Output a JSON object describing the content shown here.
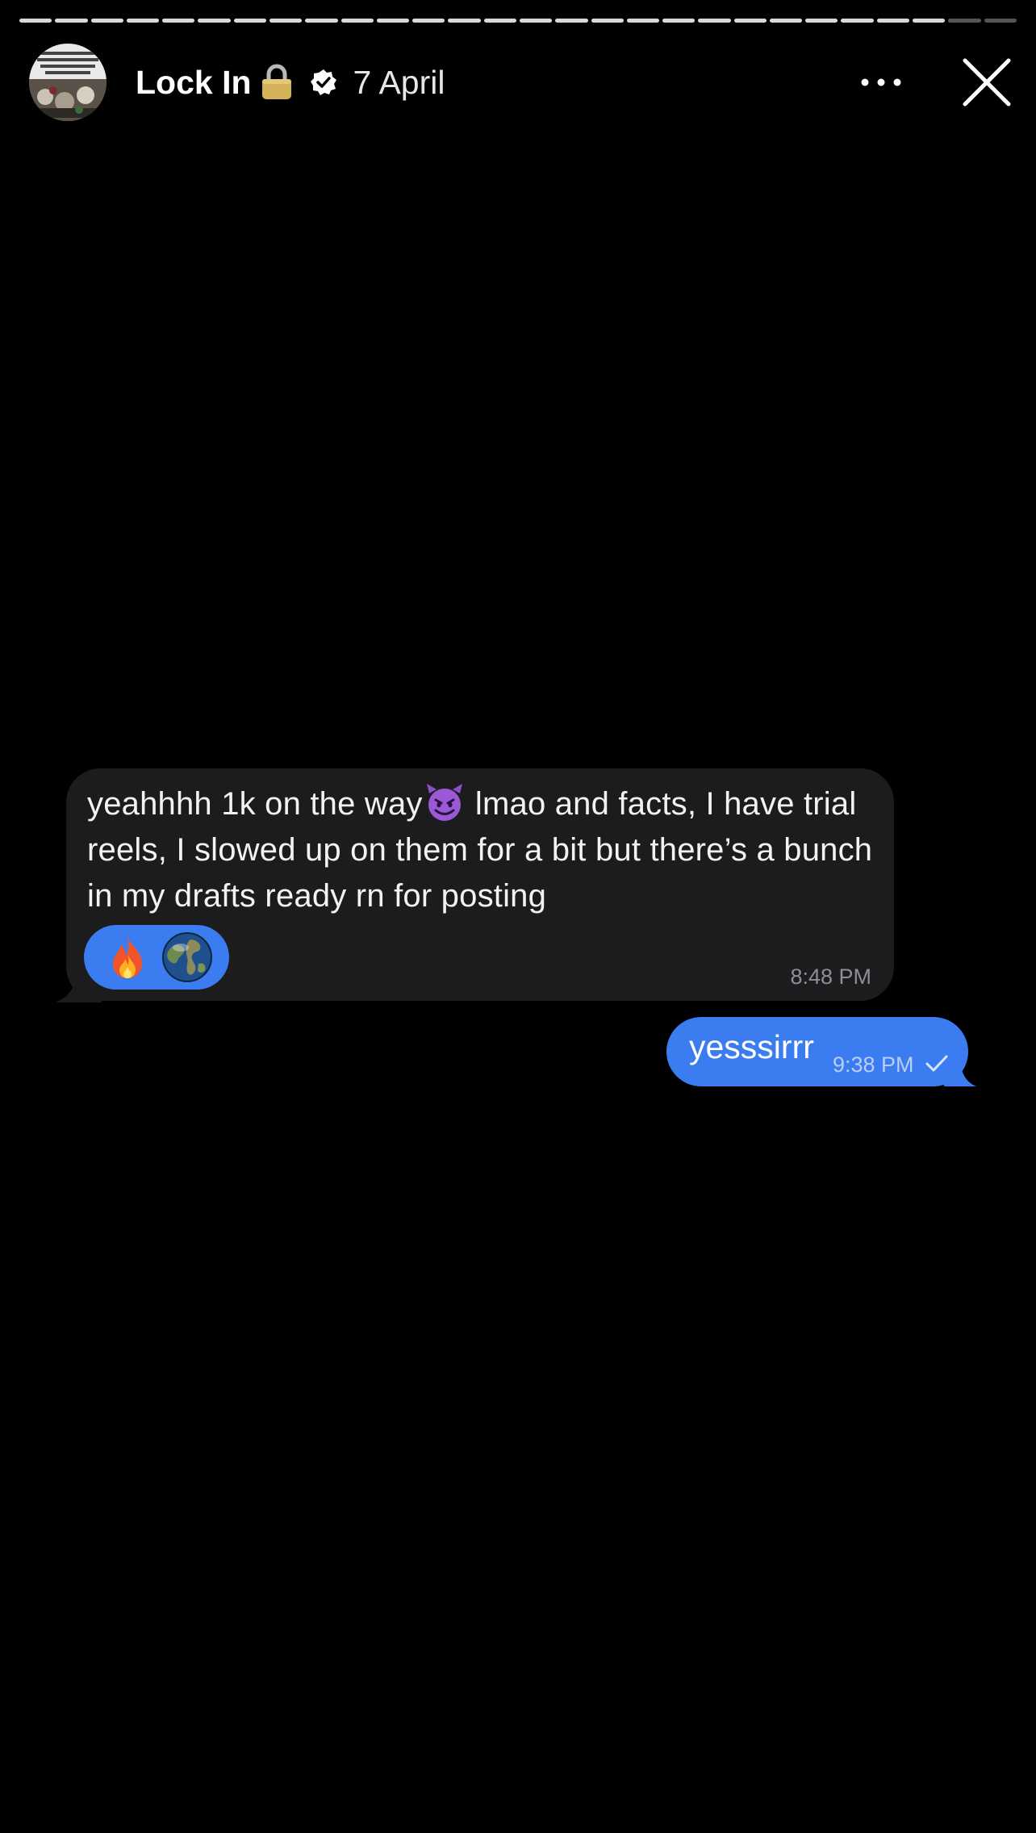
{
  "story": {
    "segments_total": 28,
    "segments_viewed": 26
  },
  "header": {
    "username": "Lock In",
    "date": "7 April",
    "verified": true,
    "avatar_icon": "profile-avatar",
    "lock_emoji_icon": "lock-icon",
    "more_icon": "more-dots-icon",
    "close_icon": "close-icon"
  },
  "conversation": {
    "received": {
      "text_before_emoji": "yeahhhh 1k on the way",
      "emoji_icon": "smiling-devil-emoji",
      "text_after_emoji": " lmao and facts, I have trial reels, I slowed up on them for a bit but there’s a bunch in my drafts ready rn for posting",
      "reactions": [
        "fire-emoji",
        "globe-emoji"
      ],
      "time": "8:48 PM"
    },
    "sent": {
      "text": "yesssirrr",
      "time": "9:38 PM",
      "status_icon": "check-icon"
    }
  },
  "colors": {
    "background": "#000000",
    "received_bubble": "#1c1c1e",
    "sent_bubble": "#3b7cf0",
    "reaction_pill": "#3b7cf0",
    "progress_viewed": "#d9d9d9",
    "progress_unviewed": "#555555"
  }
}
